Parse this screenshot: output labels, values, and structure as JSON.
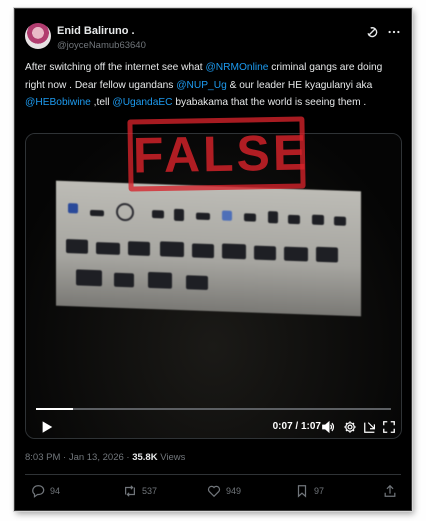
{
  "user": {
    "display_name": "Enid Baliruno .",
    "handle": "@joyceNamub63640"
  },
  "tweet": {
    "segments": [
      {
        "text": "After switching off the internet see what ",
        "type": "text"
      },
      {
        "text": "@NRMOnline",
        "type": "mention"
      },
      {
        "text": " criminal gangs are doing right now . Dear fellow ugandans ",
        "type": "text"
      },
      {
        "text": "@NUP_Ug",
        "type": "mention"
      },
      {
        "text": " & our leader HE kyagulanyi aka ",
        "type": "text"
      },
      {
        "text": "@HEBobiwine",
        "type": "mention"
      },
      {
        "text": " ,tell ",
        "type": "text"
      },
      {
        "text": "@UgandaEC",
        "type": "mention"
      },
      {
        "text": " byabakama that the world is seeing them .",
        "type": "text"
      }
    ]
  },
  "stamp": {
    "label": "FALSE",
    "color": "#d6222a"
  },
  "video": {
    "time_display": "0:07 / 1:07",
    "progress_fraction": 0.104
  },
  "meta": {
    "timestamp": "8:03 PM · Jan 13, 2026",
    "separator": "·",
    "views_count": "35.8K",
    "views_label": "Views"
  },
  "actions": {
    "replies": "94",
    "reposts": "537",
    "likes": "949",
    "bookmarks": "97"
  },
  "colors": {
    "background": "#000000",
    "text": "#e7e9ea",
    "muted": "#71767b",
    "link": "#1d9bf0"
  }
}
